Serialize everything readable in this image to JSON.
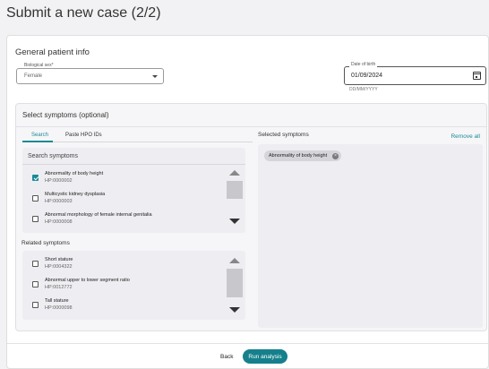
{
  "page": {
    "title": "Submit a new case (2/2)"
  },
  "patient_info": {
    "heading": "General patient info",
    "sex": {
      "label": "Biological sex",
      "required_mark": "*",
      "value": "Female"
    },
    "dob": {
      "label": "Date of birth",
      "value": "01/09/2024",
      "hint": "DD/MM/YYYY"
    }
  },
  "symptoms": {
    "heading": "Select symptoms (optional)",
    "tabs": [
      {
        "label": "Search",
        "active": true
      },
      {
        "label": "Paste HPO IDs",
        "active": false
      }
    ],
    "search_label": "Search symptoms",
    "search_results": [
      {
        "name": "Abnormality of body height",
        "code": "HP:0000002",
        "checked": true
      },
      {
        "name": "Multicystic kidney dysplasia",
        "code": "HP:0000003",
        "checked": false
      },
      {
        "name": "Abnormal morphology of female internal genitalia",
        "code": "HP:0000008",
        "checked": false
      }
    ],
    "related_heading": "Related symptoms",
    "related": [
      {
        "name": "Short stature",
        "code": "HP:0004322",
        "checked": false
      },
      {
        "name": "Abnormal upper to lower segment ratio",
        "code": "HP:0012772",
        "checked": false
      },
      {
        "name": "Tall stature",
        "code": "HP:0000098",
        "checked": false
      }
    ],
    "selected_heading": "Selected symptoms",
    "remove_all": "Remove all",
    "selected_chips": [
      {
        "label": "Abnormality of body height"
      }
    ]
  },
  "footer": {
    "back_label": "Back",
    "run_label": "Run analysis"
  },
  "colors": {
    "accent": "#15808c",
    "page_bg": "#f2f2f4"
  }
}
